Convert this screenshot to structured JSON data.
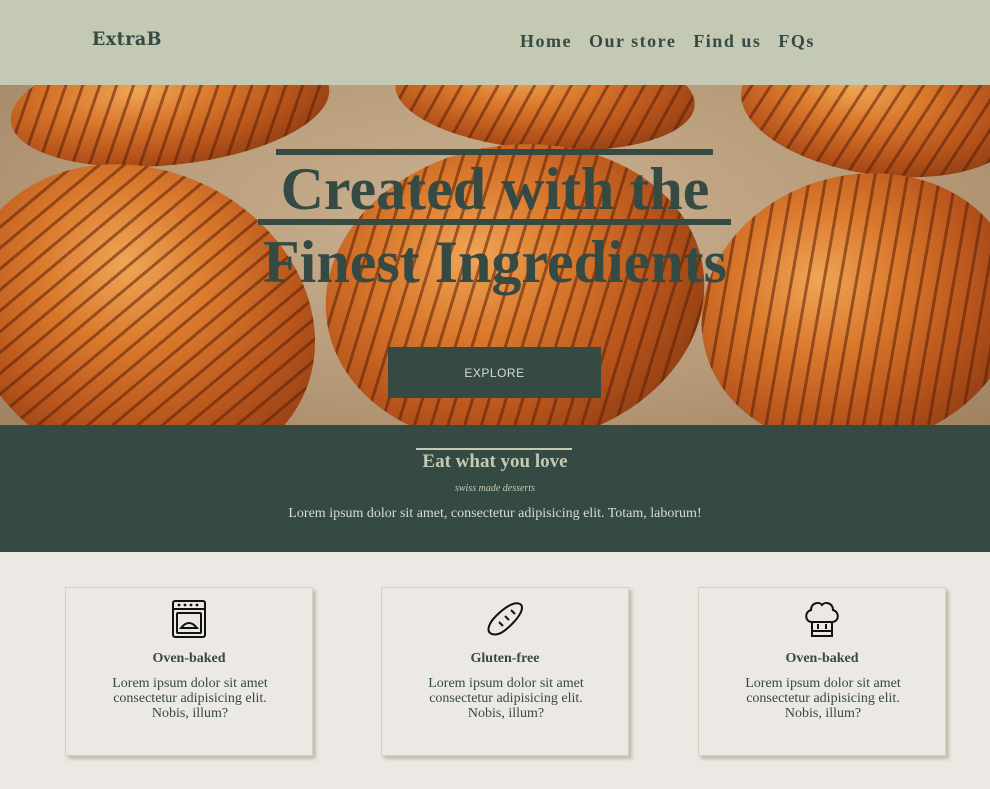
{
  "header": {
    "logo": "ExtraB",
    "nav": [
      "Home",
      "Our store",
      "Find us",
      "FQs"
    ]
  },
  "hero": {
    "title_line1": "Created with the",
    "title_line2": "Finest Ingredients",
    "button_label": "EXPLORE"
  },
  "band": {
    "title": "Eat what you love",
    "tagline": "swiss made desserts",
    "text": "Lorem ipsum dolor sit amet, consectetur adipisicing elit. Totam, laborum!"
  },
  "cards": [
    {
      "icon": "oven-icon",
      "title": "Oven-baked",
      "text": "Lorem ipsum dolor sit amet consectetur adipisicing elit. Nobis, illum?"
    },
    {
      "icon": "bread-icon",
      "title": "Gluten-free",
      "text": "Lorem ipsum dolor sit amet consectetur adipisicing elit. Nobis, illum?"
    },
    {
      "icon": "chef-hat-icon",
      "title": "Oven-baked",
      "text": "Lorem ipsum dolor sit amet consectetur adipisicing elit. Nobis, illum?"
    }
  ],
  "colors": {
    "header_bg": "#c3c9b2",
    "dark_green": "#354a43",
    "page_bg": "#ece8e3"
  }
}
